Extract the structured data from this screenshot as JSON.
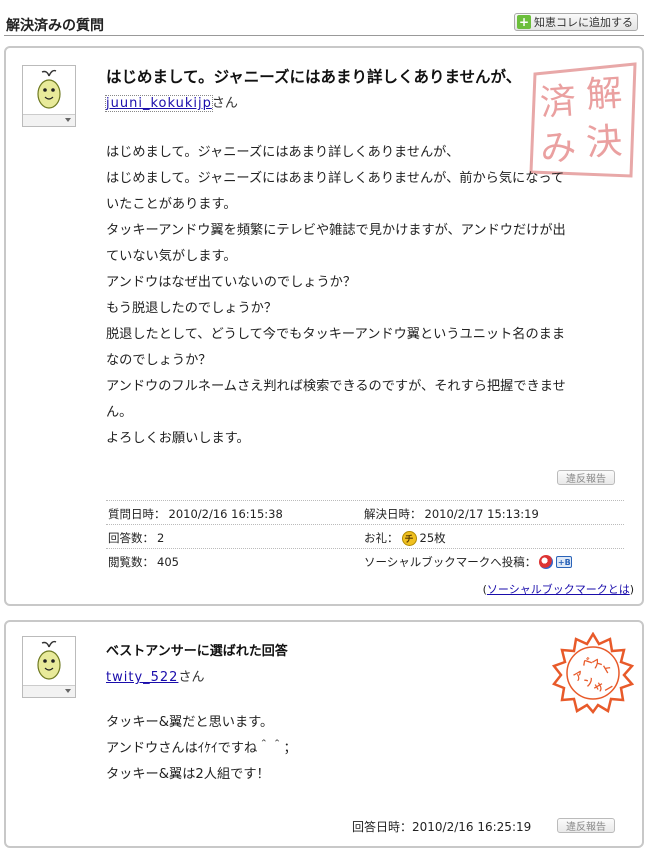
{
  "header": {
    "title": "解決済みの質問",
    "add_button_label": "知恵コレに追加する"
  },
  "question": {
    "title": "はじめまして。ジャニーズにはあまり詳しくありませんが、",
    "user_name": "juuni_kokukijp",
    "user_suffix": "さん",
    "stamp_text": [
      "解",
      "済",
      "決",
      "み"
    ],
    "body_lines": [
      "はじめまして。ジャニーズにはあまり詳しくありませんが、",
      "はじめまして。ジャニーズにはあまり詳しくありませんが、前から気になって",
      "いたことがあります。",
      "タッキーアンドウ翼を頻繁にテレビや雑誌で見かけますが、アンドウだけが出",
      "ていない気がします。",
      "アンドウはなぜ出ていないのでしょうか？",
      "もう脱退したのでしょうか？",
      "脱退したとして、どうして今でもタッキーアンドウ翼というユニット名のまま",
      "なのでしょうか？",
      "アンドウのフルネームさえ判れば検索できるのですが、それすら把握できませ",
      "ん。",
      "よろしくお願いします。"
    ],
    "report_label": "違反報告",
    "asked_label": "質問日時：",
    "asked_value": "2010/2/16 16:15:38",
    "resolved_label": "解決日時：",
    "resolved_value": "2010/2/17 15:13:19",
    "answers_label": "回答数：",
    "answers_value": "2",
    "reward_label": "お礼：",
    "reward_icon_text": "チ",
    "reward_value": "25枚",
    "views_label": "閲覧数：",
    "views_value": "405",
    "social_label": "ソーシャルブックマークへ投稿：",
    "social_icon_b_text": "+B",
    "bookmark_note_open": "(",
    "bookmark_note_link": "ソーシャルブックマークとは",
    "bookmark_note_close": ")"
  },
  "answer": {
    "title": "ベストアンサーに選ばれた回答",
    "user_name": "twity_522",
    "user_suffix": "さん",
    "stamp_text": [
      "ベ",
      "ス",
      "ト",
      "ア",
      "ン",
      "サ",
      "ー"
    ],
    "body_lines": [
      "タッキー&翼だと思います。",
      "アンドウさんはｲｹｲですね＾＾；",
      "タッキー&翼は2人組です！"
    ],
    "answered_label": "回答日時：",
    "answered_value": "2010/2/16 16:25:19",
    "report_label": "違反報告"
  },
  "colors": {
    "link": "#1a0dab",
    "panel_border": "#c8c8c8",
    "stamp_resolved": "#e8a8a8",
    "stamp_best": "#e85a2a",
    "add_plus": "#6cbf3c"
  }
}
